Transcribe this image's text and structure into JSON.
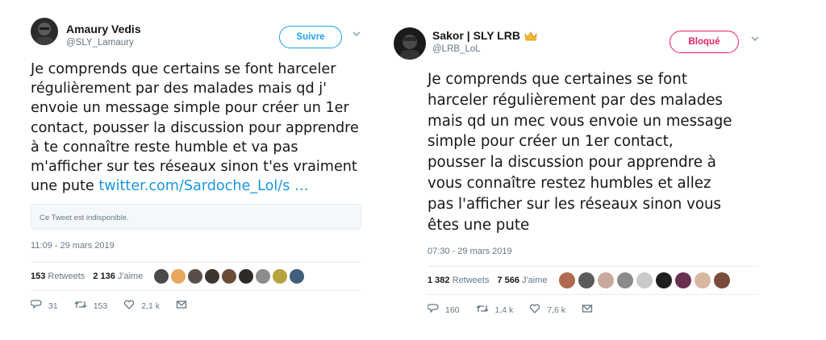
{
  "tweets": [
    {
      "author_name": "Amaury Vedis",
      "handle": "@SLY_Lamaury",
      "follow_label": "Suivre",
      "text": "Je comprends que certains se font harceler\nrégulièrement par des malades mais qd j'\nenvoie un message simple pour créer un 1er\ncontact, pousser la discussion pour apprendre\nà te connaître reste humble et va pas\nm'afficher sur tes réseaux sinon t'es vraiment\nune pute ",
      "link": "twitter.com/Sardoche_Lol/s …",
      "unavailable": "Ce Tweet est indisponible.",
      "time": "11:09 - 29 mars 2019",
      "retweets_count": "153",
      "retweets_label": "Retweets",
      "likes_count": "2 136",
      "likes_label": "J'aime",
      "liker_colors": [
        "#4a4a4a",
        "#e8a75c",
        "#5b4e49",
        "#3c3530",
        "#6b4b3a",
        "#2e2a28",
        "#8c8c8c",
        "#b5a43d",
        "#3f5f7a"
      ],
      "replies": "31",
      "retweets": "153",
      "likes": "2,1 k"
    },
    {
      "author_name": "Sakor | SLY LRB",
      "handle": "@LRB_LoL",
      "follow_label": "Bloqué",
      "text": "Je comprends que certaines se font\nharceler régulièrement par des malades\nmais qd un mec vous envoie un message\nsimple pour créer un 1er contact,\npousser la discussion pour apprendre à\nvous connaître restez humbles et allez\npas l'afficher sur les réseaux sinon vous\nêtes une pute",
      "time": "07:30 - 29 mars 2019",
      "retweets_count": "1 382",
      "retweets_label": "Retweets",
      "likes_count": "7 566",
      "likes_label": "J'aime",
      "liker_colors": [
        "#b06a50",
        "#5a5a5a",
        "#c9a99b",
        "#8a8a8a",
        "#c9c9c9",
        "#1e1e1e",
        "#6a3050",
        "#d8b7a0",
        "#7a4a3a"
      ],
      "replies": "160",
      "retweets": "1,4 k",
      "likes": "7,6 k"
    }
  ],
  "colors": {
    "accent": "#1da1f2",
    "blocked": "#e0245e",
    "muted": "#657786"
  }
}
